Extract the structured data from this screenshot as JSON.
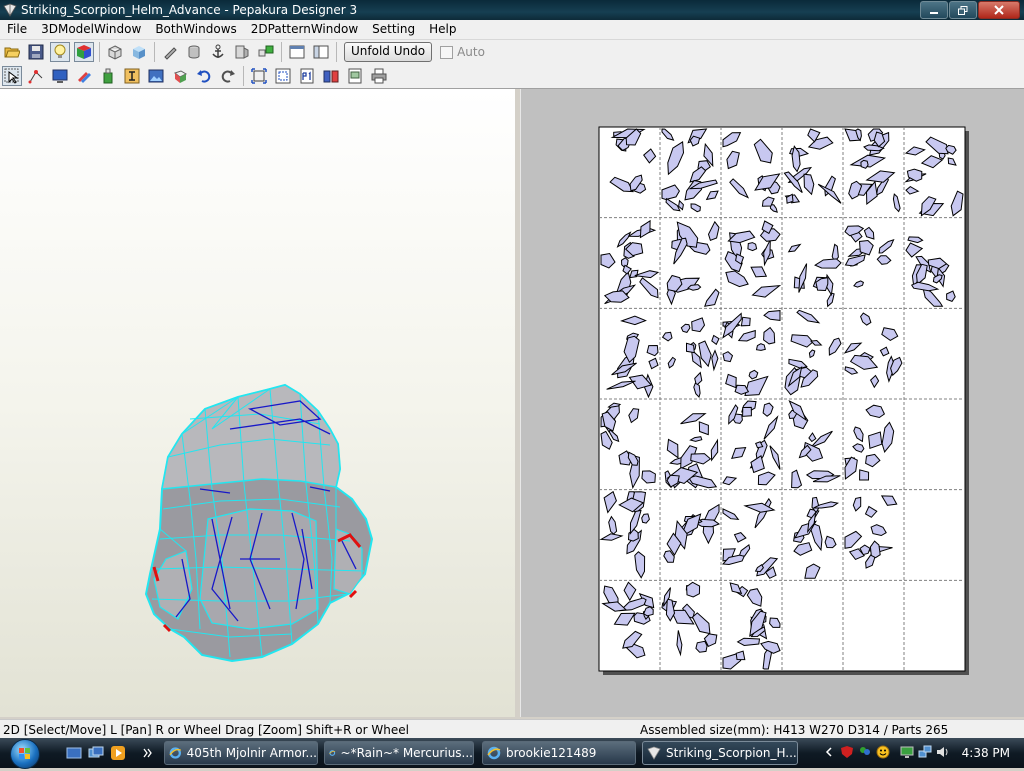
{
  "window": {
    "title": "Striking_Scorpion_Helm_Advance - Pepakura Designer 3"
  },
  "menu": {
    "items": [
      "File",
      "3DModelWindow",
      "BothWindows",
      "2DPatternWindow",
      "Setting",
      "Help"
    ]
  },
  "toolbar": {
    "unfold_undo_label": "Unfold Undo",
    "auto_label": "Auto"
  },
  "status": {
    "left": "2D [Select/Move] L [Pan] R or Wheel Drag [Zoom] Shift+R or Wheel",
    "right": "Assembled size(mm): H413 W270 D314 / Parts 265"
  },
  "taskbar": {
    "tasks": [
      "405th Mjolnir Armor...",
      "~*Rain~* Mercurius...",
      "brookie121489",
      "Striking_Scorpion_H..."
    ],
    "clock": "4:38 PM"
  },
  "colors": {
    "mesh_edge": "#22e6f0",
    "mesh_fold": "#1818c8",
    "cut_edge": "#e01010",
    "part_fill": "#c8c8f0"
  },
  "pattern_grid": {
    "columns": 6,
    "rows": 6
  }
}
